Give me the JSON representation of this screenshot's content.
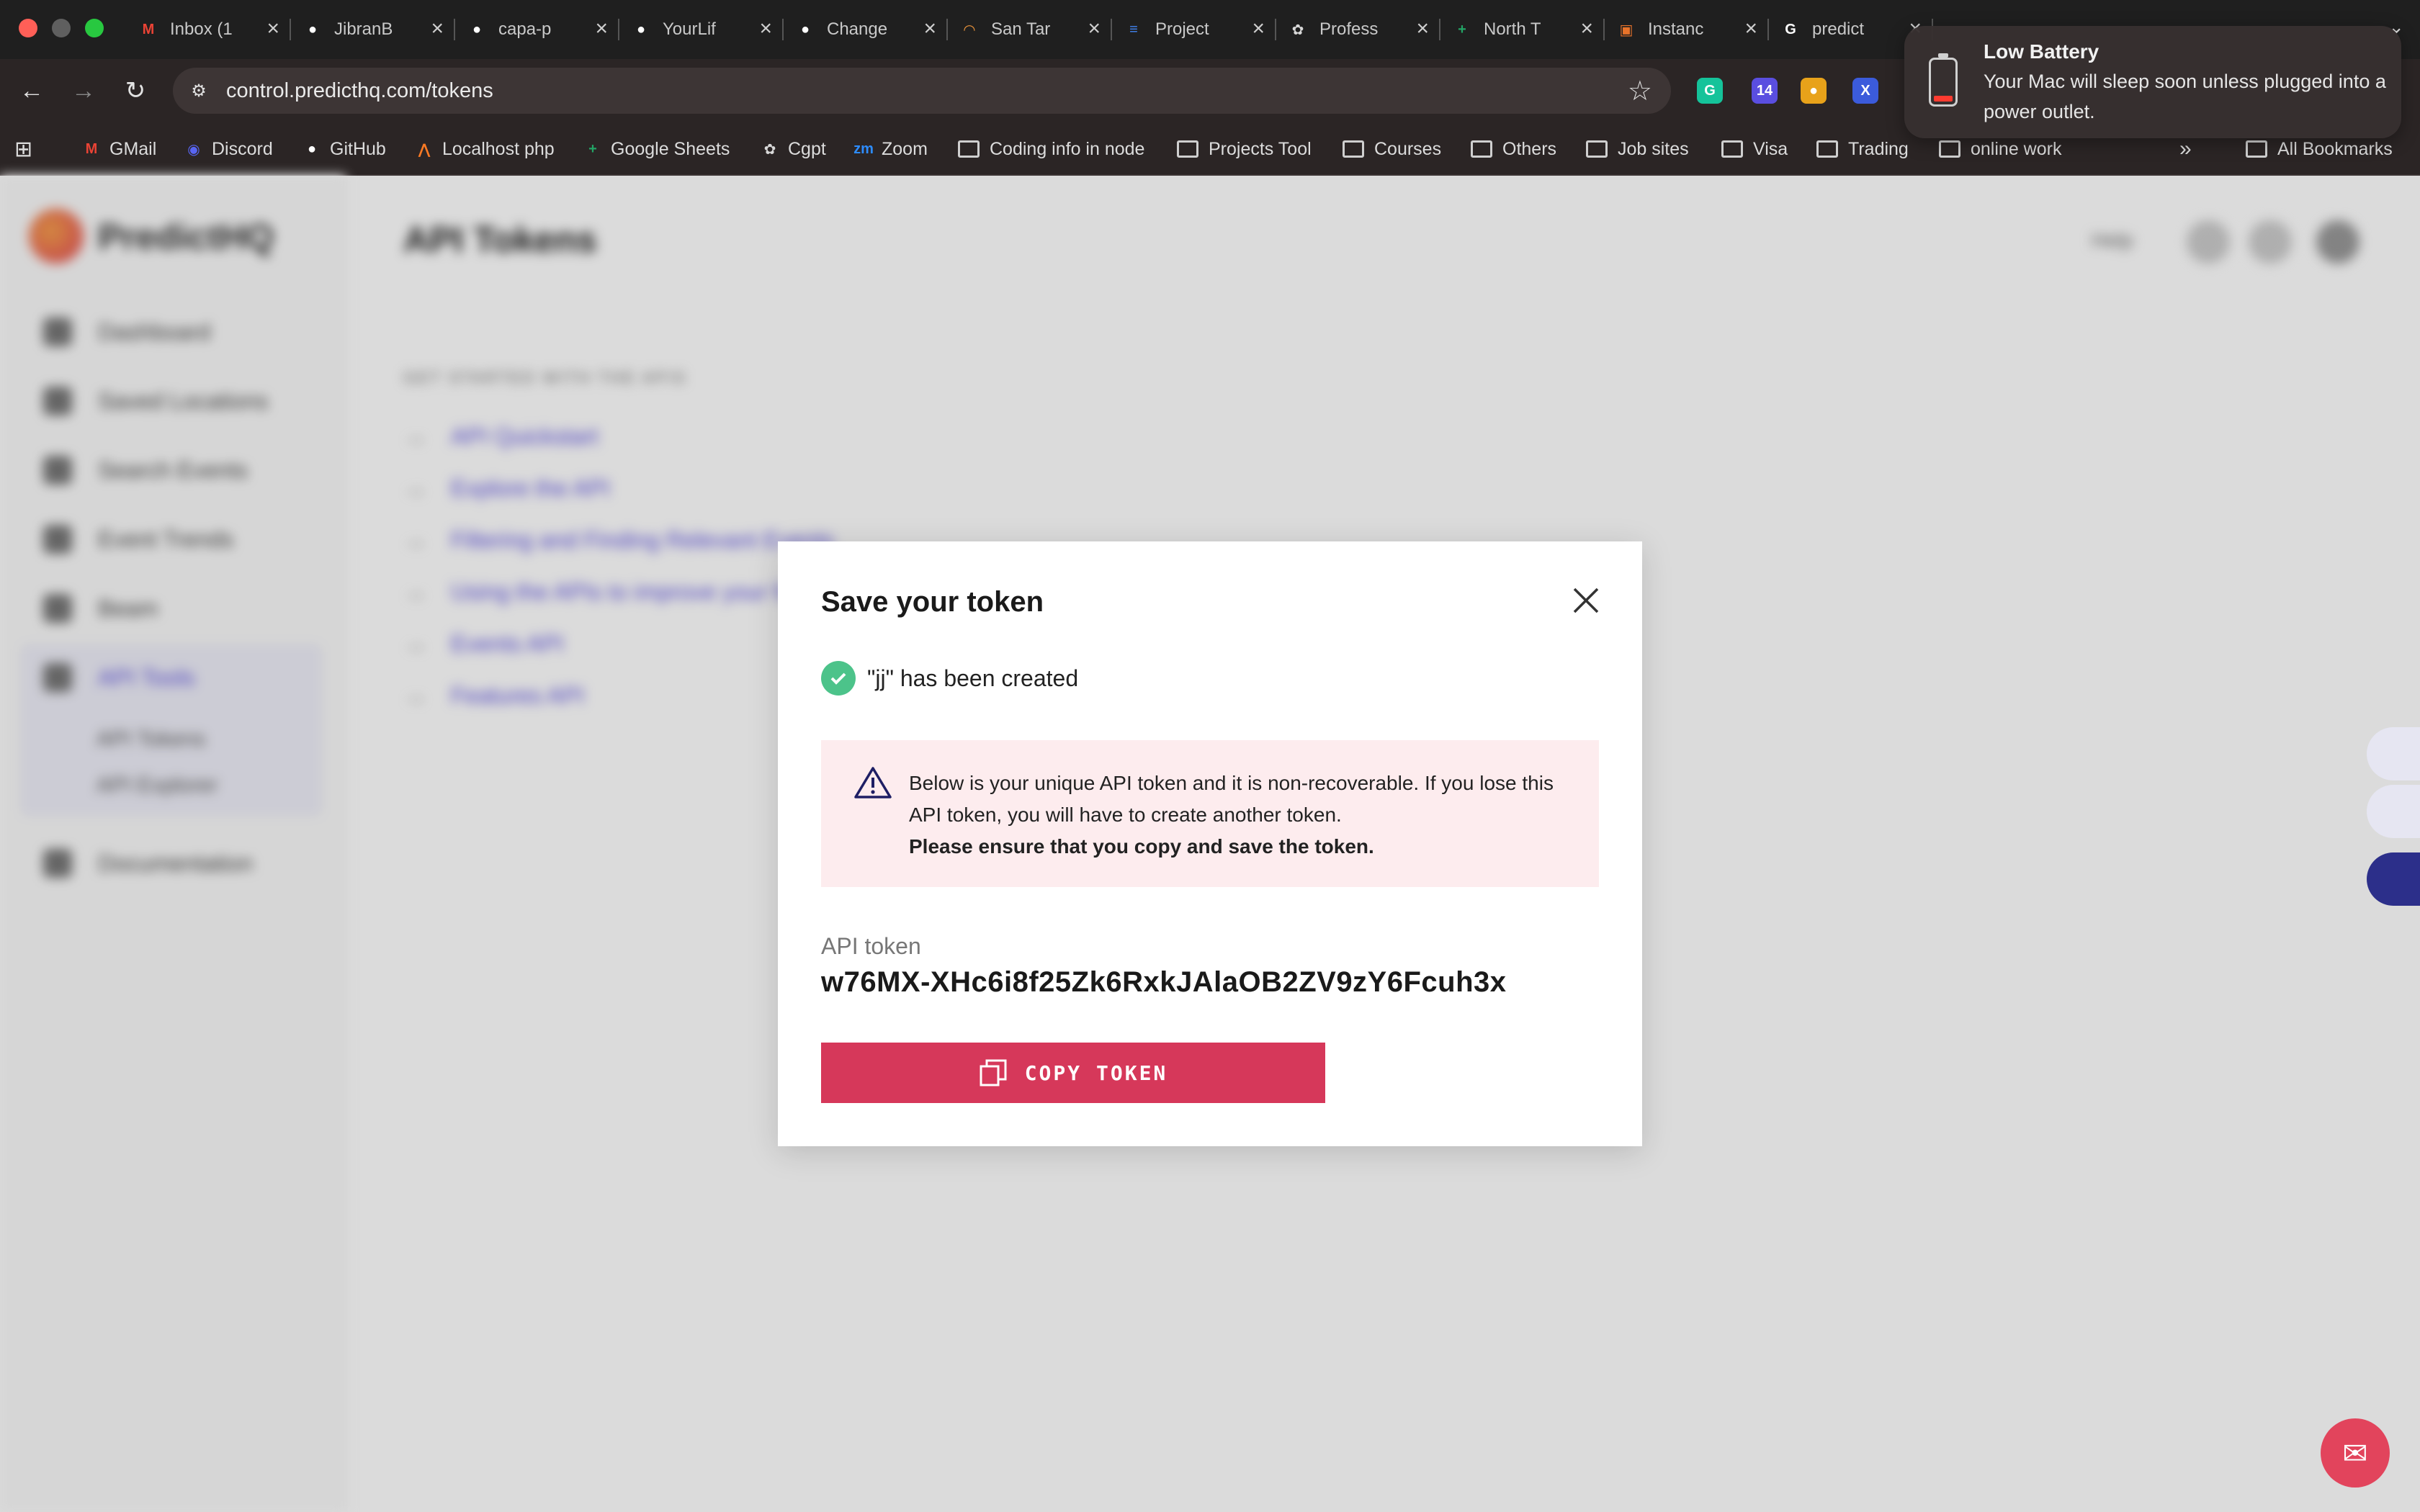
{
  "browser": {
    "tabs": [
      {
        "title": "Inbox (1",
        "icon": "gmail-icon",
        "color": "#ea4335",
        "glyph": "M"
      },
      {
        "title": "JibranB",
        "icon": "github-icon",
        "color": "#ffffff",
        "glyph": "●"
      },
      {
        "title": "capa-p",
        "icon": "github-icon",
        "color": "#ffffff",
        "glyph": "●"
      },
      {
        "title": "YourLif",
        "icon": "github-icon",
        "color": "#ffffff",
        "glyph": "●"
      },
      {
        "title": "Change",
        "icon": "github-icon",
        "color": "#ffffff",
        "glyph": "●"
      },
      {
        "title": "San Tar",
        "icon": "sun-icon",
        "color": "#e8923a",
        "glyph": "◠"
      },
      {
        "title": "Project",
        "icon": "google-docs-icon",
        "color": "#4285f4",
        "glyph": "≡"
      },
      {
        "title": "Profess",
        "icon": "openai-icon",
        "color": "#d9d9d9",
        "glyph": "✿"
      },
      {
        "title": "North T",
        "icon": "google-sheets-icon",
        "color": "#23a566",
        "glyph": "+"
      },
      {
        "title": "Instanc",
        "icon": "aws-icon",
        "color": "#e8732a",
        "glyph": "▣"
      },
      {
        "title": "predict",
        "icon": "google-icon",
        "color": "#ffffff",
        "glyph": "G"
      }
    ],
    "url": "control.predicthq.com/tokens",
    "extensions": [
      {
        "icon": "grammarly-icon",
        "color": "#15c39a",
        "glyph": "G"
      },
      {
        "icon": "extension-badge-icon",
        "color": "#5a4ee0",
        "glyph": "14"
      },
      {
        "icon": "squirrel-icon",
        "color": "#e8a21a",
        "glyph": "●"
      },
      {
        "icon": "x-extension-icon",
        "color": "#3b5bdb",
        "glyph": "X"
      }
    ],
    "bookmarks": [
      {
        "label": "GMail",
        "icon": "gmail-icon",
        "folder": false,
        "color": "#ea4335",
        "glyph": "M"
      },
      {
        "label": "Discord",
        "icon": "discord-icon",
        "folder": false,
        "color": "#5865f2",
        "glyph": "◉"
      },
      {
        "label": "GitHub",
        "icon": "github-icon",
        "folder": false,
        "color": "#ffffff",
        "glyph": "●"
      },
      {
        "label": "Localhost php",
        "icon": "xampp-icon",
        "folder": false,
        "color": "#fb7a24",
        "glyph": "⋀"
      },
      {
        "label": "Google Sheets",
        "icon": "google-sheets-icon",
        "folder": false,
        "color": "#23a566",
        "glyph": "+"
      },
      {
        "label": "Cgpt",
        "icon": "openai-icon",
        "folder": false,
        "color": "#d9d9d9",
        "glyph": "✿"
      },
      {
        "label": "Zoom",
        "icon": "zoom-icon",
        "folder": false,
        "color": "#2d8cff",
        "glyph": "zm"
      },
      {
        "label": "Coding info in node",
        "icon": "folder-icon",
        "folder": true
      },
      {
        "label": "Projects Tool",
        "icon": "folder-icon",
        "folder": true
      },
      {
        "label": "Courses",
        "icon": "folder-icon",
        "folder": true
      },
      {
        "label": "Others",
        "icon": "folder-icon",
        "folder": true
      },
      {
        "label": "Job sites",
        "icon": "folder-icon",
        "folder": true
      },
      {
        "label": "Visa",
        "icon": "folder-icon",
        "folder": true
      },
      {
        "label": "Trading",
        "icon": "folder-icon",
        "folder": true
      },
      {
        "label": "online work",
        "icon": "folder-icon",
        "folder": true
      }
    ],
    "all_bookmarks": "All Bookmarks"
  },
  "app": {
    "logo_text": "PredictHQ",
    "page_title": "API Tokens",
    "sidebar": [
      {
        "label": "Dashboard"
      },
      {
        "label": "Saved Locations"
      },
      {
        "label": "Search Events"
      },
      {
        "label": "Event Trends"
      },
      {
        "label": "Beam"
      },
      {
        "label": "API Tools"
      }
    ],
    "sidebar_sub": [
      "API Tokens",
      "API Explorer"
    ],
    "sidebar_docs": "Documentation",
    "help_label": "Help",
    "section_heading": "GET STARTED WITH THE APIS",
    "links": [
      "API Quickstart",
      "Explore the API",
      "Filtering and Finding Relevant Events",
      "Using the APIs to improve your forecasts",
      "Events API",
      "Features API"
    ]
  },
  "modal": {
    "title": "Save your token",
    "success": "\"jj\" has been created",
    "warning_line1": "Below is your unique API token and it is non-recoverable. If you lose this API token, you will have to create another token.",
    "warning_strong": "Please ensure that you copy and save the token.",
    "token_label": "API token",
    "token_value": "w76MX-XHc6i8f25Zk6RxkJAlaOB2ZV9zY6Fcuh3x",
    "copy_button": "COPY TOKEN",
    "accent_color": "#d6385a",
    "success_color": "#4cc38a"
  },
  "notification": {
    "title": "Low Battery",
    "body": "Your Mac will sleep soon unless plugged into a power outlet."
  }
}
